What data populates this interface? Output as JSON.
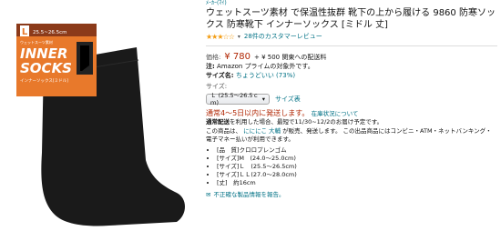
{
  "product_image": {
    "package": {
      "size_letter": "L",
      "size_text": "25.5~26.5cm",
      "subtitle": "ウェットスーツ素材",
      "logo_line1": "INNER",
      "logo_line2": "SOCKS",
      "desc": "インナーソックス[ミドル]",
      "colors": {
        "package": "#e8792b",
        "header": "#8b3a1a",
        "sock": "#1a1a1a"
      }
    }
  },
  "brand": "ﾒｰｶｰ(ﾏｲ)",
  "title": "ウェットスーツ素材 で保温性抜群 靴下の上から履ける 9860 防寒ソックス 防寒靴下 インナーソックス [ミドル 丈]",
  "rating": {
    "stars": "★★★☆☆",
    "reviews": "28件のカスタマーレビュー"
  },
  "price": {
    "label": "価格:",
    "value": "¥ 780",
    "shipping": "+ ¥ 500 関東への配送料"
  },
  "notice": {
    "label": "注:",
    "text": "Amazon プライムの対象外です。"
  },
  "size_name": {
    "label": "サイズ名:",
    "value": "ちょうどいい (73%)"
  },
  "size": {
    "label": "サイズ:",
    "selected": "Ｌ (25.5～26.5ｃｍ)",
    "chart_link": "サイズ表"
  },
  "availability": {
    "text": "通常4～5日以内に発送します。",
    "stock_link": "在庫状況について"
  },
  "delivery": {
    "bold": "通常配送",
    "text": "を利用した場合、最短で11/30~12/2のお届け予定です。"
  },
  "seller": {
    "prefix": "この商品は、",
    "store1": "にににこ",
    "store2": "大輔",
    "suffix": "が販売、発送します。 この出品商品にはコンビニ・ATM・ネットバンキング・電子マネー払いが利用できます。"
  },
  "features": [
    "[品　質]クロロプレンゴム",
    "[サイズ]M　(24.0～25.0cm)",
    "[サイズ]Ｌ　(25.5～26.5cm)",
    "[サイズ]ＬＬ(27.0～28.0cm)",
    "[丈]　約16cm"
  ],
  "report_link": "不正確な製品情報を報告。"
}
